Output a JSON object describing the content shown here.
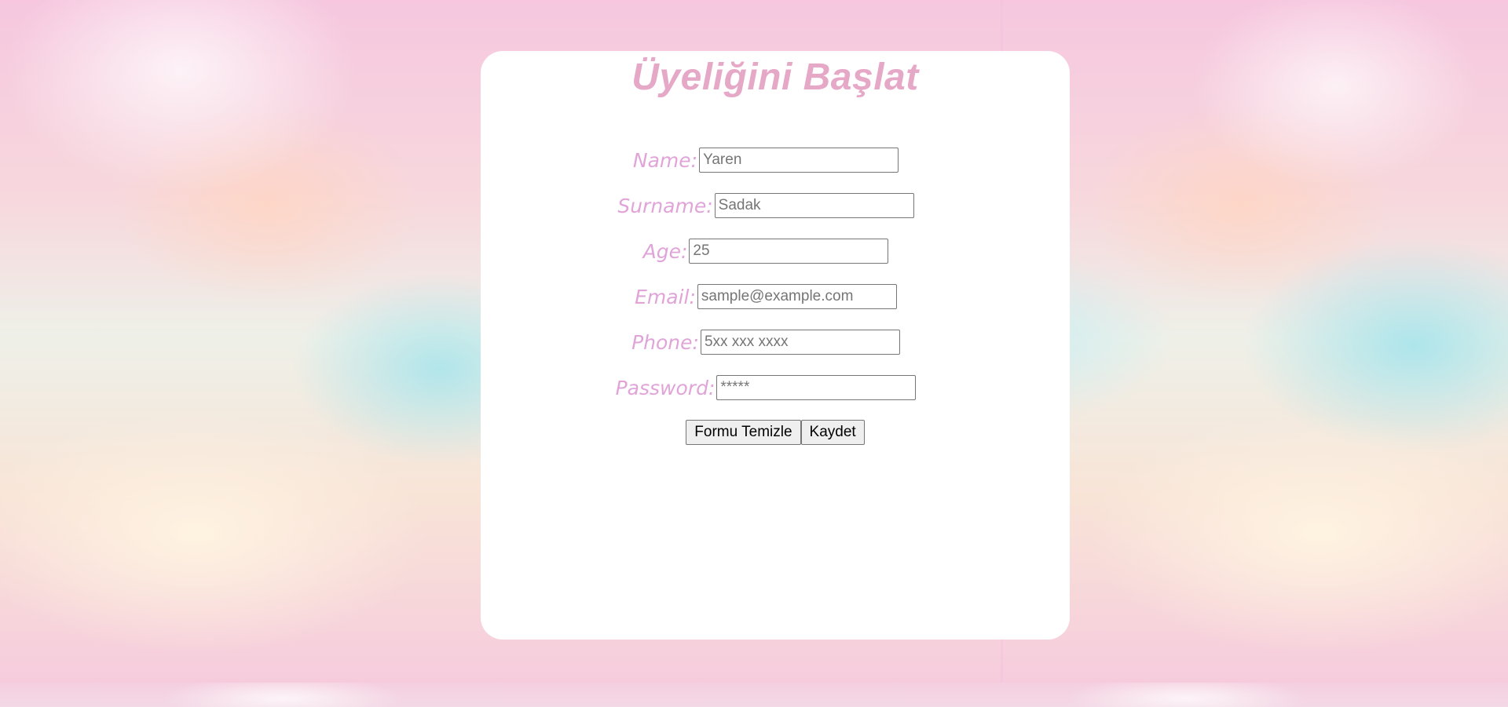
{
  "page": {
    "title": "Üyeliğini Başlat"
  },
  "form": {
    "fields": [
      {
        "label": "Name:",
        "placeholder": "Yaren"
      },
      {
        "label": "Surname:",
        "placeholder": "Sadak"
      },
      {
        "label": "Age:",
        "placeholder": "25"
      },
      {
        "label": "Email:",
        "placeholder": "sample@example.com"
      },
      {
        "label": "Phone:",
        "placeholder": "5xx xxx xxxx"
      },
      {
        "label": "Password:",
        "placeholder": "*****"
      }
    ],
    "buttons": {
      "reset_label": "Formu Temizle",
      "submit_label": "Kaydet"
    }
  },
  "colors": {
    "title": "#e6a8c7",
    "labels": "#e0a4d9",
    "card_background": "#ffffff"
  }
}
